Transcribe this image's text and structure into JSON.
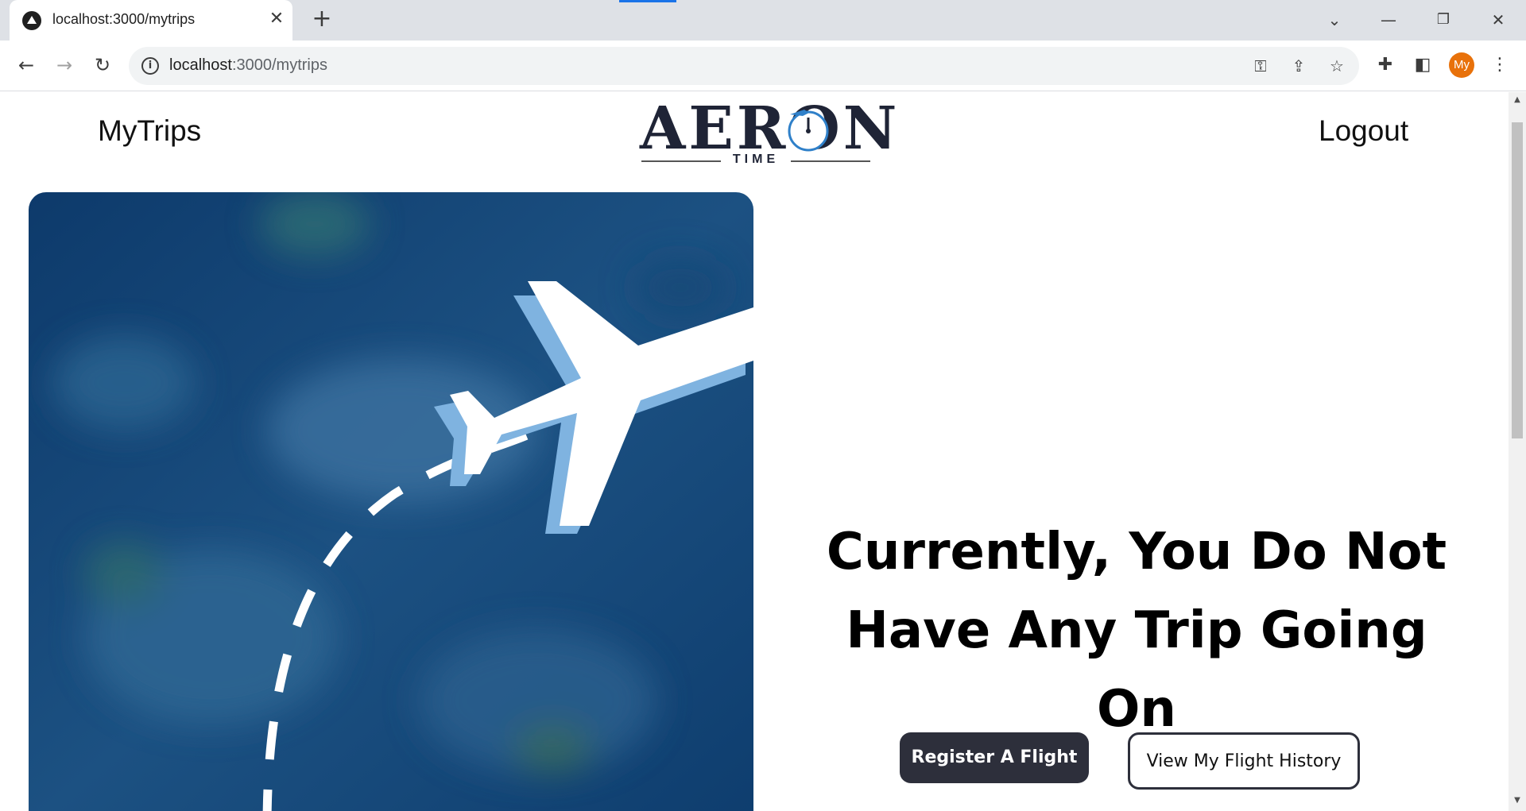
{
  "browser": {
    "tab_title": "localhost:3000/mytrips",
    "url_host": "localhost",
    "url_path": ":3000/mytrips",
    "profile_initials": "My"
  },
  "nav": {
    "left_link": "MyTrips",
    "right_link": "Logout"
  },
  "logo": {
    "word": "AERON",
    "subtitle": "TIME"
  },
  "main": {
    "empty_line1": "Currently, You Do Not",
    "empty_line2": "Have Any Trip Going On",
    "register_button": "Register A Flight",
    "history_button": "View My Flight History"
  },
  "colors": {
    "brand_dark": "#2d2f3b",
    "hero_blue": "#123f70",
    "plane_shadow": "#7fb3e0",
    "profile_orange": "#e8710a"
  }
}
